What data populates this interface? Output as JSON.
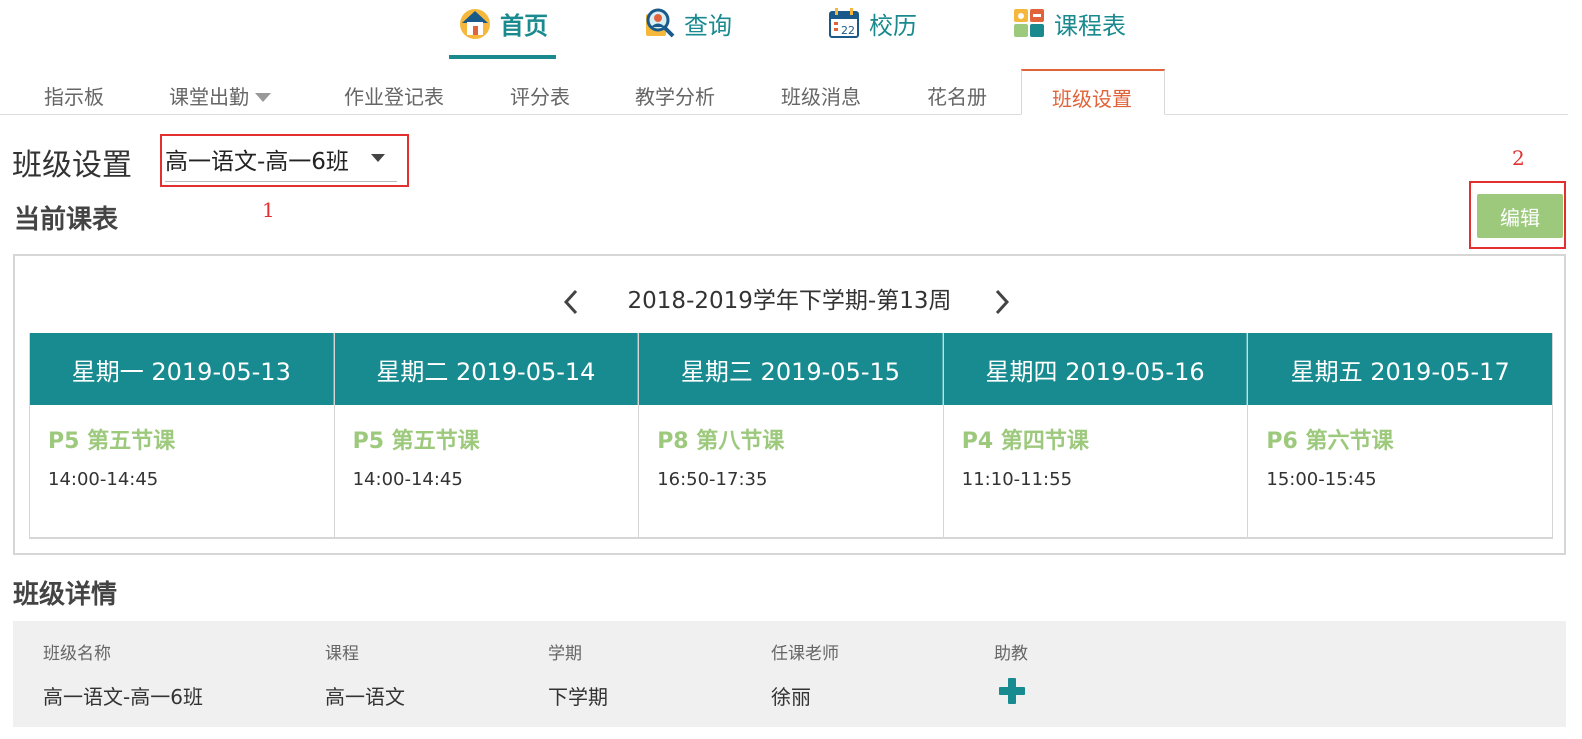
{
  "topnav": {
    "items": [
      {
        "label": "首页",
        "icon": "home-icon"
      },
      {
        "label": "查询",
        "icon": "search-person-icon"
      },
      {
        "label": "校历",
        "icon": "calendar-icon"
      },
      {
        "label": "课程表",
        "icon": "timetable-icon"
      }
    ],
    "active_index": 0,
    "accent_color": "#1a8a8f"
  },
  "subtabs": {
    "items": [
      {
        "label": "指示板"
      },
      {
        "label": "课堂出勤"
      },
      {
        "label": "作业登记表"
      },
      {
        "label": "评分表"
      },
      {
        "label": "教学分析"
      },
      {
        "label": "班级消息"
      },
      {
        "label": "花名册"
      },
      {
        "label": "班级设置"
      }
    ],
    "active_label": "班级设置",
    "active_color": "#e0633a"
  },
  "header": {
    "title": "班级设置",
    "class_select_value": "高一语文-高一6班"
  },
  "annotations": {
    "mark1": "1",
    "mark2": "2",
    "color": "#e23030"
  },
  "current_schedule": {
    "title": "当前课表",
    "edit_label": "编辑",
    "week_label": "2018-2019学年下学期-第13周",
    "days": [
      {
        "header": "星期一 2019-05-13",
        "period": "P5 第五节课",
        "time": "14:00-14:45"
      },
      {
        "header": "星期二 2019-05-14",
        "period": "P5 第五节课",
        "time": "14:00-14:45"
      },
      {
        "header": "星期三 2019-05-15",
        "period": "P8 第八节课",
        "time": "16:50-17:35"
      },
      {
        "header": "星期四 2019-05-16",
        "period": "P4 第四节课",
        "time": "11:10-11:55"
      },
      {
        "header": "星期五 2019-05-17",
        "period": "P6 第六节课",
        "time": "15:00-15:45"
      }
    ],
    "header_color": "#178b90",
    "period_color": "#9dc97d"
  },
  "class_details": {
    "title": "班级详情",
    "labels": {
      "class_name": "班级名称",
      "course": "课程",
      "term": "学期",
      "teacher": "任课老师",
      "assistant": "助教"
    },
    "values": {
      "class_name": "高一语文-高一6班",
      "course": "高一语文",
      "term": "下学期",
      "teacher": "徐丽"
    }
  }
}
